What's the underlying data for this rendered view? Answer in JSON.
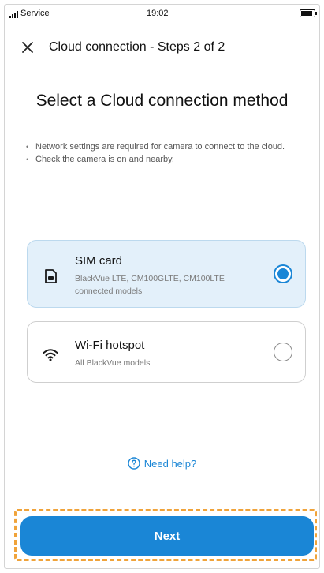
{
  "status_bar": {
    "carrier": "Service",
    "time": "19:02",
    "signal_icon": "signal-icon",
    "battery_icon": "battery-icon",
    "battery_level": 0.9
  },
  "header": {
    "close_icon": "close-icon",
    "title": "Cloud connection - Steps 2 of 2"
  },
  "main": {
    "title": "Select a Cloud connection method",
    "notes": [
      "Network settings are required for camera to connect to the cloud.",
      "Check the camera is on and nearby."
    ],
    "options": [
      {
        "icon": "sim-card-icon",
        "title": "SIM card",
        "description": "BlackVue LTE, CM100GLTE, CM100LTE connected models",
        "selected": true
      },
      {
        "icon": "wifi-icon",
        "title": "Wi-Fi hotspot",
        "description": "All BlackVue models",
        "selected": false
      }
    ],
    "help": {
      "icon": "help-circle-icon",
      "label": "Need help?"
    }
  },
  "footer": {
    "next_label": "Next"
  },
  "colors": {
    "accent": "#1a86d6",
    "selected_bg": "#e3f0fa",
    "highlight": "#f0a33a"
  }
}
